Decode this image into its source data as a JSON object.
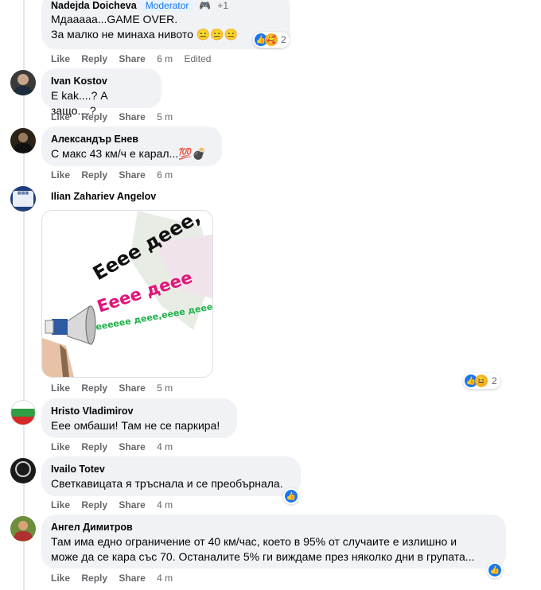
{
  "actions": {
    "like": "Like",
    "reply": "Reply",
    "share": "Share"
  },
  "comments": [
    {
      "author": "Nadejda Doicheva",
      "badge": "Moderator",
      "badge_extra": "+1",
      "lines": [
        "Мдааааа...GAME OVER.",
        "За малко не минаха нивото 😑😑😑"
      ],
      "time": "6 m",
      "edited": "Edited",
      "reactions": "2"
    },
    {
      "author": "Ivan Kostov",
      "lines": [
        "Е kak....? А защо....?"
      ],
      "time": "5 m"
    },
    {
      "author": "Александър Енев",
      "lines": [
        "С макс 43 км/ч е карал...💯💣"
      ],
      "time": "6 m"
    },
    {
      "author": "Ilian Zahariev Angelov",
      "image_text": [
        "Ееее деее,",
        "Ееее деее",
        "ееееее деее,ееее деее"
      ],
      "time": "5 m",
      "reactions": "2"
    },
    {
      "author": "Hristo Vladimirov",
      "lines": [
        "Еее омбаши! Там не се паркира!"
      ],
      "time": "4 m"
    },
    {
      "author": "Ivailo Totev",
      "lines": [
        "Светкавицата я тръснала и се преобърнала."
      ],
      "time": "4 m"
    },
    {
      "author": "Ангел Димитров",
      "lines": [
        "Там има едно ограничение от 40 км/час, което в 95% от случаите е излишно и",
        "може да се кара със 70. Останалите 5% ги виждаме през няколко дни в групата..."
      ],
      "time": "4 m"
    }
  ],
  "colors": {
    "bubble": "#f0f2f5",
    "accent": "#1877f2",
    "meta": "#65676b"
  }
}
